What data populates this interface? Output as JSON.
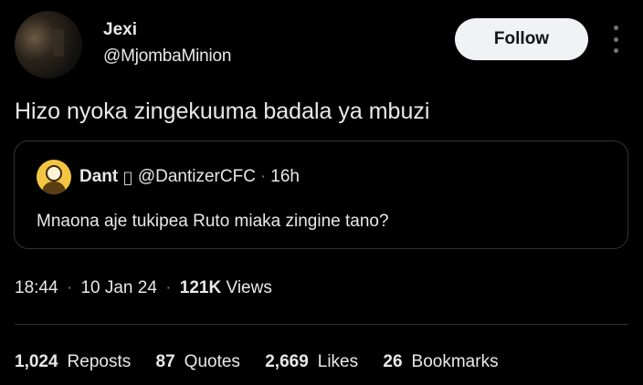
{
  "author": {
    "name": "Jexi",
    "handle": "@MjombaMinion"
  },
  "follow_label": "Follow",
  "tweet_text": "Hizo nyoka zingekuuma badala ya mbuzi",
  "quoted": {
    "name": "Dant",
    "badge_icon": "apple-icon",
    "handle": "@DantizerCFC",
    "separator": "·",
    "time": "16h",
    "text": "Mnaona aje tukipea Ruto miaka zingine tano?"
  },
  "meta": {
    "time": "18:44",
    "date": "10 Jan 24",
    "views_count": "121K",
    "views_label": "Views",
    "separator": "·"
  },
  "stats": [
    {
      "count": "1,024",
      "label": "Reposts"
    },
    {
      "count": "87",
      "label": "Quotes"
    },
    {
      "count": "2,669",
      "label": "Likes"
    },
    {
      "count": "26",
      "label": "Bookmarks"
    }
  ]
}
